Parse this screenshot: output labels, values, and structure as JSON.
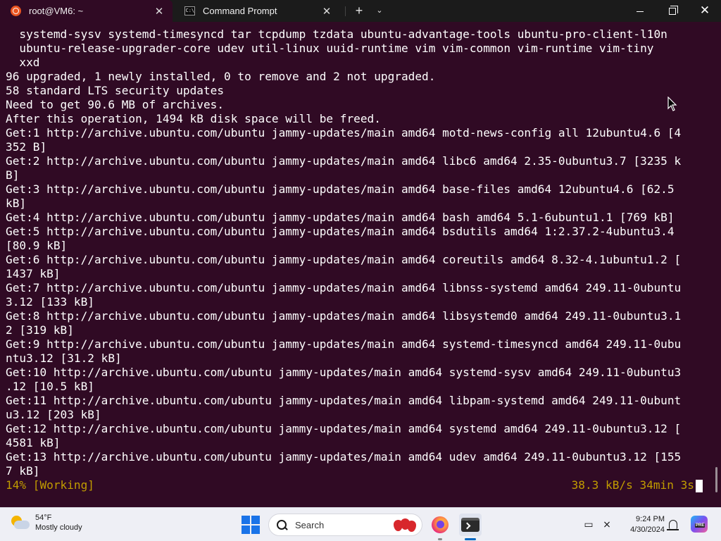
{
  "tabs": [
    {
      "title": "root@VM6: ~",
      "icon": "ubuntu-icon",
      "active": true
    },
    {
      "title": "Command Prompt",
      "icon": "cmd-icon",
      "active": false
    }
  ],
  "terminal": {
    "lines": [
      "  systemd-sysv systemd-timesyncd tar tcpdump tzdata ubuntu-advantage-tools ubuntu-pro-client-l10n",
      "  ubuntu-release-upgrader-core udev util-linux uuid-runtime vim vim-common vim-runtime vim-tiny",
      "  xxd",
      "96 upgraded, 1 newly installed, 0 to remove and 2 not upgraded.",
      "58 standard LTS security updates",
      "Need to get 90.6 MB of archives.",
      "After this operation, 1494 kB disk space will be freed.",
      "Get:1 http://archive.ubuntu.com/ubuntu jammy-updates/main amd64 motd-news-config all 12ubuntu4.6 [4",
      "352 B]",
      "Get:2 http://archive.ubuntu.com/ubuntu jammy-updates/main amd64 libc6 amd64 2.35-0ubuntu3.7 [3235 k",
      "B]",
      "Get:3 http://archive.ubuntu.com/ubuntu jammy-updates/main amd64 base-files amd64 12ubuntu4.6 [62.5",
      "kB]",
      "Get:4 http://archive.ubuntu.com/ubuntu jammy-updates/main amd64 bash amd64 5.1-6ubuntu1.1 [769 kB]",
      "Get:5 http://archive.ubuntu.com/ubuntu jammy-updates/main amd64 bsdutils amd64 1:2.37.2-4ubuntu3.4",
      "[80.9 kB]",
      "Get:6 http://archive.ubuntu.com/ubuntu jammy-updates/main amd64 coreutils amd64 8.32-4.1ubuntu1.2 [",
      "1437 kB]",
      "Get:7 http://archive.ubuntu.com/ubuntu jammy-updates/main amd64 libnss-systemd amd64 249.11-0ubuntu",
      "3.12 [133 kB]",
      "Get:8 http://archive.ubuntu.com/ubuntu jammy-updates/main amd64 libsystemd0 amd64 249.11-0ubuntu3.1",
      "2 [319 kB]",
      "Get:9 http://archive.ubuntu.com/ubuntu jammy-updates/main amd64 systemd-timesyncd amd64 249.11-0ubu",
      "ntu3.12 [31.2 kB]",
      "Get:10 http://archive.ubuntu.com/ubuntu jammy-updates/main amd64 systemd-sysv amd64 249.11-0ubuntu3",
      ".12 [10.5 kB]",
      "Get:11 http://archive.ubuntu.com/ubuntu jammy-updates/main amd64 libpam-systemd amd64 249.11-0ubunt",
      "u3.12 [203 kB]",
      "Get:12 http://archive.ubuntu.com/ubuntu jammy-updates/main amd64 systemd amd64 249.11-0ubuntu3.12 [",
      "4581 kB]",
      "Get:13 http://archive.ubuntu.com/ubuntu jammy-updates/main amd64 udev amd64 249.11-0ubuntu3.12 [155",
      "7 kB]"
    ],
    "status_left": "14% [Working]",
    "status_right": "38.3 kB/s 34min 3s",
    "background": "#300a24",
    "text_color": "#ffffff",
    "status_color": "#c19c00"
  },
  "taskbar": {
    "weather_temp": "54°F",
    "weather_desc": "Mostly cloudy",
    "search_label": "Search",
    "clock_time": "9:24 PM",
    "clock_date": "4/30/2024",
    "accent": "#0067c0"
  }
}
